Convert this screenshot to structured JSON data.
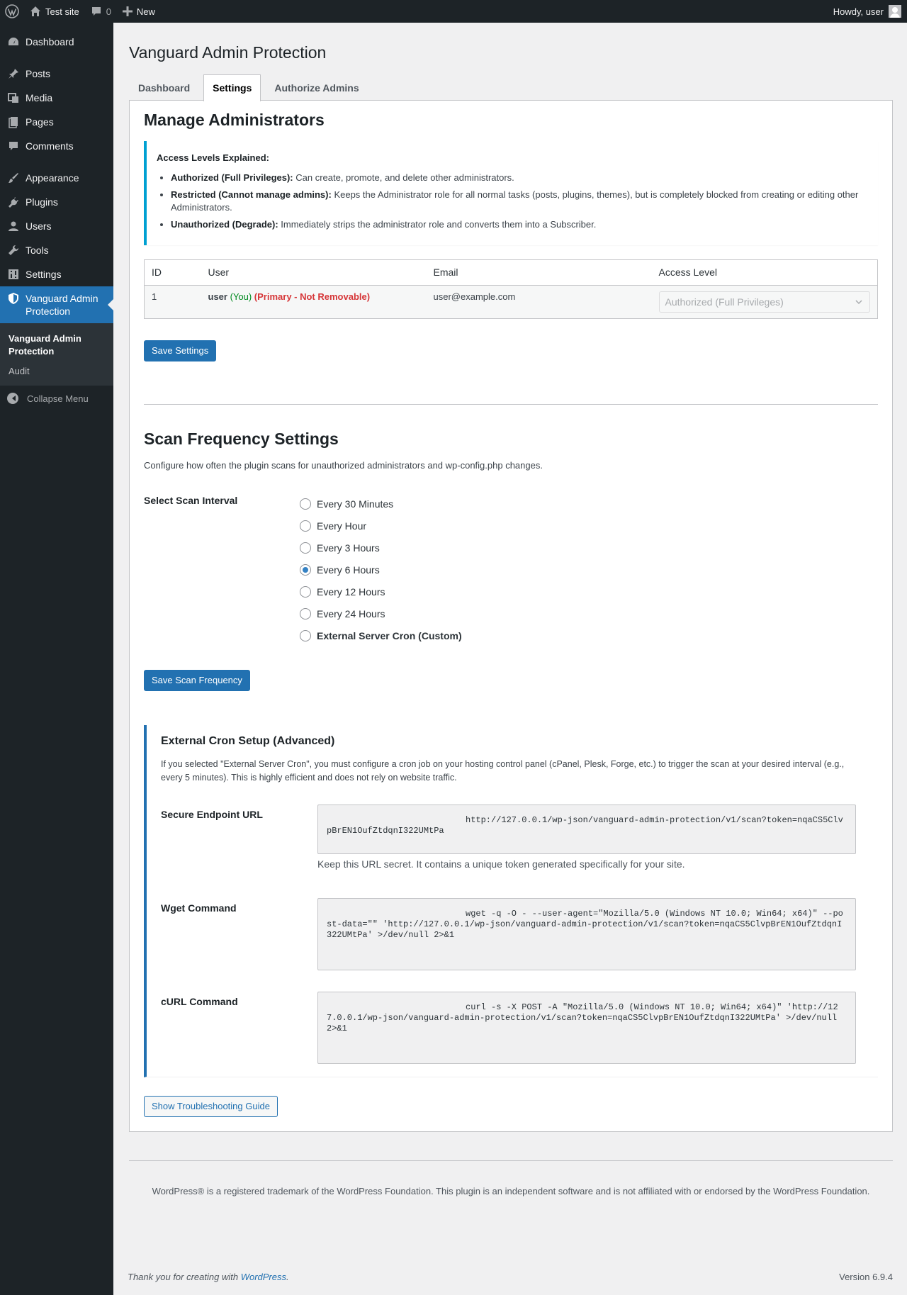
{
  "adminbar": {
    "site_name": "Test site",
    "comments_count": "0",
    "new_label": "New",
    "howdy": "Howdy, user"
  },
  "sidebar": {
    "items": [
      {
        "label": "Dashboard",
        "icon": "dashboard-icon"
      },
      {
        "label": "Posts",
        "icon": "pin-icon"
      },
      {
        "label": "Media",
        "icon": "media-icon"
      },
      {
        "label": "Pages",
        "icon": "pages-icon"
      },
      {
        "label": "Comments",
        "icon": "comment-icon"
      },
      {
        "label": "Appearance",
        "icon": "brush-icon"
      },
      {
        "label": "Plugins",
        "icon": "plug-icon"
      },
      {
        "label": "Users",
        "icon": "user-icon"
      },
      {
        "label": "Tools",
        "icon": "wrench-icon"
      },
      {
        "label": "Settings",
        "icon": "settings-icon"
      },
      {
        "label": "Vanguard Admin Protection",
        "icon": "shield-icon"
      }
    ],
    "submenu": [
      "Vanguard Admin Protection",
      "Audit"
    ],
    "collapse_label": "Collapse Menu"
  },
  "page": {
    "title": "Vanguard Admin Protection",
    "tabs": [
      "Dashboard",
      "Settings",
      "Authorize Admins"
    ]
  },
  "manage": {
    "heading": "Manage Administrators",
    "notice_title": "Access Levels Explained:",
    "levels": [
      {
        "name": "Authorized (Full Privileges):",
        "desc": " Can create, promote, and delete other administrators."
      },
      {
        "name": "Restricted (Cannot manage admins):",
        "desc": " Keeps the Administrator role for all normal tasks (posts, plugins, themes), but is completely blocked from creating or editing other Administrators."
      },
      {
        "name": "Unauthorized (Degrade):",
        "desc": " Immediately strips the administrator role and converts them into a Subscriber."
      }
    ],
    "table": {
      "headers": [
        "ID",
        "User",
        "Email",
        "Access Level"
      ],
      "rows": [
        {
          "id": "1",
          "user": "user",
          "you": " (You)",
          "primary": " (Primary - Not Removable)",
          "email": "user@example.com",
          "access": "Authorized (Full Privileges)"
        }
      ]
    },
    "save_label": "Save Settings"
  },
  "scan": {
    "heading": "Scan Frequency Settings",
    "description": "Configure how often the plugin scans for unauthorized administrators and wp-config.php changes.",
    "label": "Select Scan Interval",
    "options": [
      "Every 30 Minutes",
      "Every Hour",
      "Every 3 Hours",
      "Every 6 Hours",
      "Every 12 Hours",
      "Every 24 Hours",
      "External Server Cron (Custom)"
    ],
    "selected": "Every 6 Hours",
    "save_label": "Save Scan Frequency"
  },
  "cron": {
    "heading": "External Cron Setup (Advanced)",
    "description": "If you selected \"External Server Cron\", you must configure a cron job on your hosting control panel (cPanel, Plesk, Forge, etc.) to trigger the scan at your desired interval (e.g., every 5 minutes). This is highly efficient and does not rely on website traffic.",
    "endpoint_label": "Secure Endpoint URL",
    "endpoint": "http://127.0.0.1/wp-json/vanguard-admin-protection/v1/scan?token=nqaCS5ClvpBrEN1OufZtdqnI322UMtPa",
    "endpoint_hint": "Keep this URL secret. It contains a unique token generated specifically for your site.",
    "wget_label": "Wget Command",
    "wget": "wget -q -O - --user-agent=\"Mozilla/5.0 (Windows NT 10.0; Win64; x64)\" --post-data=\"\" 'http://127.0.0.1/wp-json/vanguard-admin-protection/v1/scan?token=nqaCS5ClvpBrEN1OufZtdqnI322UMtPa' >/dev/null 2>&1",
    "curl_label": "cURL Command",
    "curl": "curl -s -X POST -A \"Mozilla/5.0 (Windows NT 10.0; Win64; x64)\" 'http://127.0.0.1/wp-json/vanguard-admin-protection/v1/scan?token=nqaCS5ClvpBrEN1OufZtdqnI322UMtPa' >/dev/null 2>&1",
    "troubleshoot_label": "Show Troubleshooting Guide"
  },
  "footer": {
    "trademark": "WordPress® is a registered trademark of the WordPress Foundation. This plugin is an independent software and is not affiliated with or endorsed by the WordPress Foundation.",
    "thanks_prefix": "Thank you for creating with ",
    "thanks_link": "WordPress",
    "thanks_suffix": ".",
    "version": "Version 6.9.4"
  },
  "colors": {
    "accent": "#2271b1",
    "adminbar": "#1d2327",
    "notice_border": "#00a0d2",
    "error": "#d63638",
    "success": "#008a20"
  }
}
